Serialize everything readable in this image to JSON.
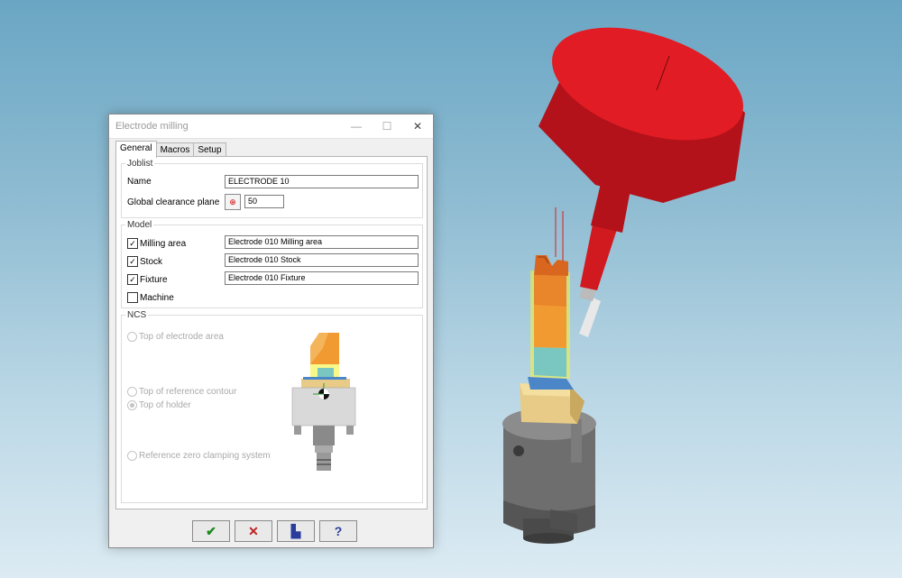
{
  "window": {
    "title": "Electrode milling",
    "minimize_glyph": "—",
    "maximize_glyph": "☐",
    "close_glyph": "✕"
  },
  "tabs": [
    {
      "label": "General"
    },
    {
      "label": "Macros"
    },
    {
      "label": "Setup"
    }
  ],
  "joblist": {
    "legend": "Joblist",
    "name_label": "Name",
    "name_value": "ELECTRODE 10",
    "clearance_label": "Global clearance plane",
    "clearance_value": "50"
  },
  "model": {
    "legend": "Model",
    "items": [
      {
        "label": "Milling area",
        "checked": true,
        "value": "Electrode 010 Milling area"
      },
      {
        "label": "Stock",
        "checked": true,
        "value": "Electrode 010 Stock"
      },
      {
        "label": "Fixture",
        "checked": true,
        "value": "Electrode 010 Fixture"
      },
      {
        "label": "Machine",
        "checked": false
      }
    ]
  },
  "ncs": {
    "legend": "NCS",
    "options": [
      {
        "label": "Top of electrode area",
        "selected": false
      },
      {
        "label": "Top of reference contour",
        "selected": false
      },
      {
        "label": "Top of holder",
        "selected": true
      },
      {
        "label": "Reference zero clamping system",
        "selected": false
      }
    ]
  },
  "buttons": {
    "ok_glyph": "✔",
    "cancel_glyph": "✕",
    "save_glyph": "▙",
    "help_glyph": "?"
  },
  "colors": {
    "tool_red": "#d11920",
    "holder_gray": "#6e6e6e",
    "electrode_orange": "#f29a32",
    "electrode_cyan": "#79c7c0",
    "base_tan": "#e8cb86",
    "highlight_yellow": "#f4f23a"
  }
}
